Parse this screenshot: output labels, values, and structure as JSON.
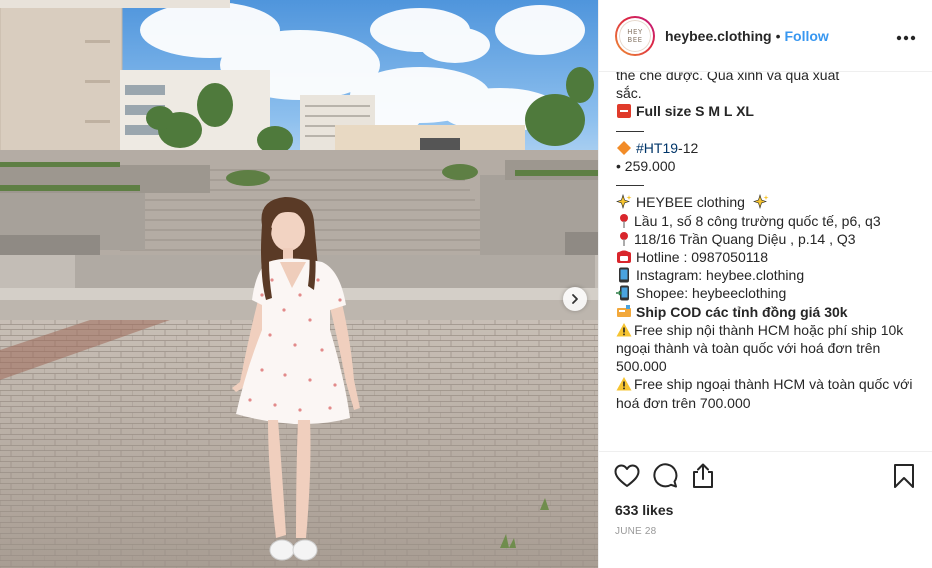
{
  "header": {
    "avatar_line1": "HEY",
    "avatar_line2": "BEE",
    "username": "heybee.clothing",
    "separator": "•",
    "follow_label": "Follow",
    "more_label": "•••"
  },
  "caption": {
    "line_partial1": "thể chế được. Quá xinh và quá xuất",
    "line_partial2": "sắc.",
    "sizes": "Full size S M L XL",
    "divider1": "——",
    "hashtag": "#HT19",
    "hashtag_suffix": "-12",
    "price": "• 259.000",
    "divider2": "——",
    "brand": "HEYBEE clothing",
    "address1": "Lầu 1, số 8 công trường quốc tế, p6, q3",
    "address2": "118/16 Trần Quang Diệu , p.14 , Q3",
    "hotline": "Hotline : 0987050118",
    "instagram": "Instagram: heybee.clothing",
    "shopee": "Shopee: heybeeclothing",
    "ship_cod": "Ship COD các tỉnh đồng giá 30k",
    "free_ship_1": "Free ship nội thành HCM hoặc phí ship 10k ngoại thành và toàn quốc với hoá đơn trên 500.000",
    "free_ship_2": "Free ship ngoại thành HCM và toàn quốc với hoá đơn trên 700.000",
    "icons": {
      "sizes": "red-square-icon",
      "hashtag": "orange-diamond-icon",
      "brand": "sparkles-icon",
      "address": "pushpin-icon",
      "hotline": "telephone-icon",
      "instagram": "mobile-phone-icon",
      "shopee": "mobile-arrow-icon",
      "ship": "tag-icon",
      "warning": "warning-icon"
    }
  },
  "actions": {
    "likes": "633 likes",
    "date": "JUNE 28",
    "icons": [
      "heart-icon",
      "comment-icon",
      "share-icon",
      "bookmark-icon"
    ]
  },
  "photo": {
    "next_icon": "chevron-right-icon"
  },
  "colors": {
    "link": "#3897f0",
    "hashtag": "#003569",
    "text": "#262626",
    "muted": "#999999",
    "border": "#efefef"
  }
}
